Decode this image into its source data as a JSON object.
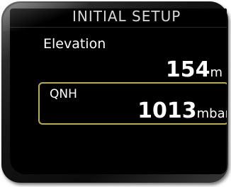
{
  "screen": {
    "title": "INITIAL SETUP"
  },
  "elevation": {
    "label": "Elevation",
    "value": "154",
    "unit": "m"
  },
  "qnh": {
    "label": "QNH",
    "value": "1013",
    "unit": "mbar"
  },
  "colors": {
    "background": "#000000",
    "text": "#ffffff",
    "selection_border": "#b8b03a"
  }
}
